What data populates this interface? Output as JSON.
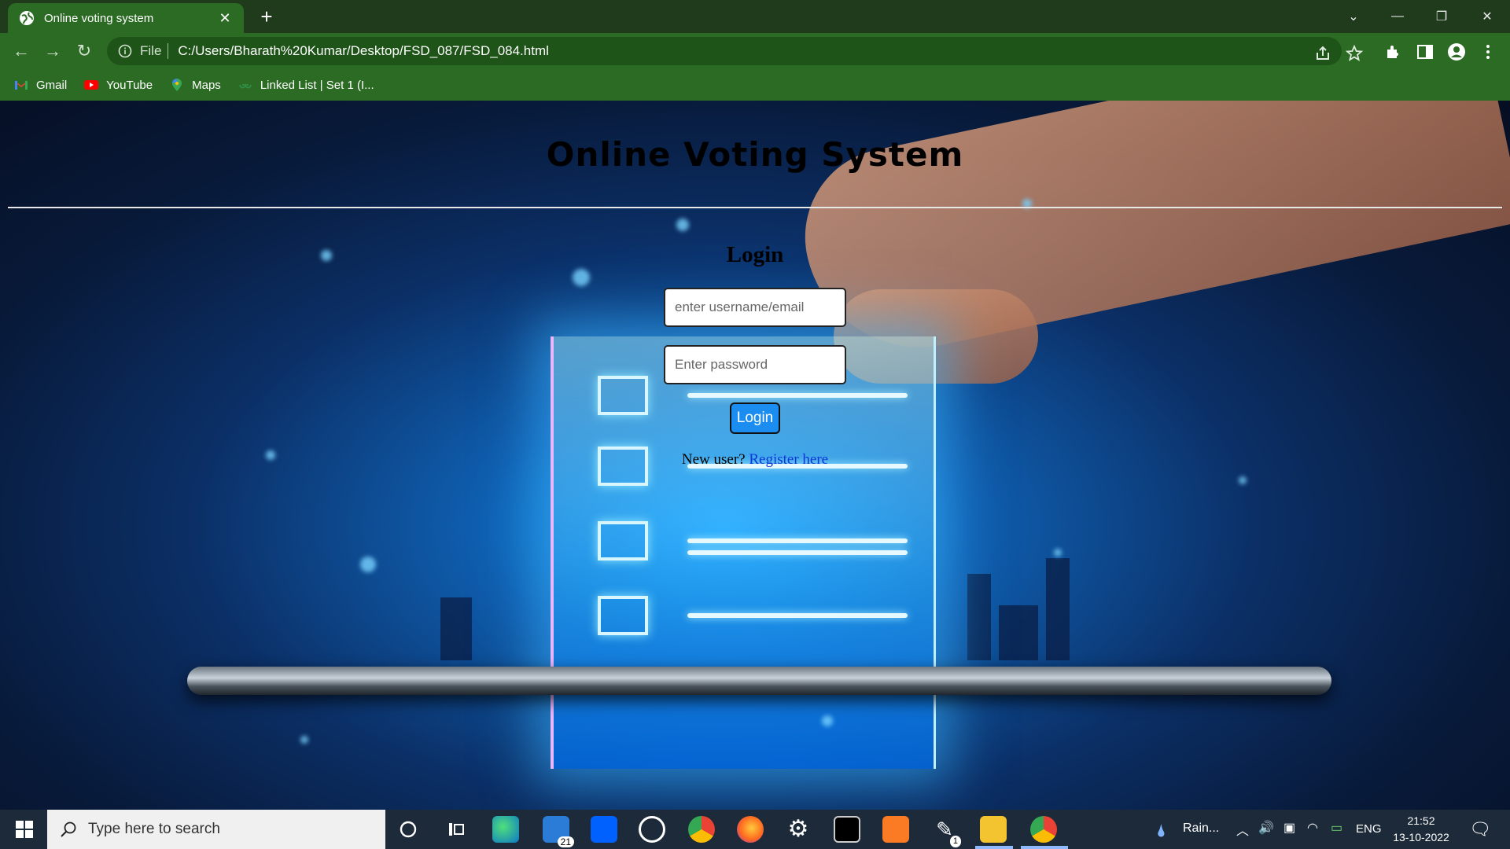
{
  "browser": {
    "tab_title": "Online voting system",
    "address_file_label": "File",
    "address_url": "C:/Users/Bharath%20Kumar/Desktop/FSD_087/FSD_084.html",
    "bookmarks": [
      {
        "label": "Gmail",
        "icon": "gmail-icon"
      },
      {
        "label": "YouTube",
        "icon": "youtube-icon"
      },
      {
        "label": "Maps",
        "icon": "maps-icon"
      },
      {
        "label": "Linked List | Set 1 (I...",
        "icon": "gfg-icon"
      }
    ]
  },
  "page": {
    "title": "Online Voting System",
    "login_heading": "Login",
    "username_placeholder": "enter username/email",
    "password_placeholder": "Enter password",
    "login_button": "Login",
    "new_user_text": "New user?",
    "register_link": "Register here"
  },
  "taskbar": {
    "search_placeholder": "Type here to search",
    "mail_badge": "21",
    "pen_badge": "1",
    "weather": "Rain...",
    "language": "ENG",
    "time": "21:52",
    "date": "13-10-2022"
  },
  "colors": {
    "tabbar": "#1f3b1c",
    "toolbar": "#2c6b23",
    "login_button": "#1c8df0",
    "link": "#0b36d8"
  }
}
